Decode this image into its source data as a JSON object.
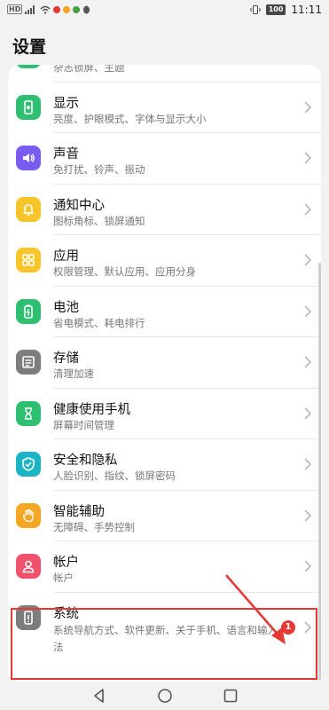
{
  "status_bar": {
    "left_chip": "HD",
    "battery_label": "100",
    "time": "11:11",
    "dot_colors": [
      "#e53935",
      "#f5a623",
      "#43a047"
    ]
  },
  "page_title": "设置",
  "items": [
    {
      "id": "theme",
      "title": "",
      "sub": "杂志锁屏、主题",
      "color": "#2fbf71",
      "icon": "theme-icon"
    },
    {
      "id": "display",
      "title": "显示",
      "sub": "亮度、护眼模式、字体与显示大小",
      "color": "#2fbf71",
      "icon": "display-icon"
    },
    {
      "id": "sound",
      "title": "声音",
      "sub": "免打扰、铃声、振动",
      "color": "#7a5cf0",
      "icon": "speaker-icon"
    },
    {
      "id": "notify",
      "title": "通知中心",
      "sub": "图标角标、锁屏通知",
      "color": "#f7c52a",
      "icon": "bell-icon"
    },
    {
      "id": "apps",
      "title": "应用",
      "sub": "权限管理、默认应用、应用分身",
      "color": "#f7c52a",
      "icon": "apps-grid-icon"
    },
    {
      "id": "battery",
      "title": "电池",
      "sub": "省电模式、耗电排行",
      "color": "#2fbf71",
      "icon": "battery-icon"
    },
    {
      "id": "storage",
      "title": "存储",
      "sub": "清理加速",
      "color": "#7d7d7d",
      "icon": "storage-icon"
    },
    {
      "id": "health",
      "title": "健康使用手机",
      "sub": "屏幕时间管理",
      "color": "#2fbf71",
      "icon": "hourglass-icon"
    },
    {
      "id": "security",
      "title": "安全和隐私",
      "sub": "人脸识别、指纹、锁屏密码",
      "color": "#1bb4c4",
      "icon": "shield-icon"
    },
    {
      "id": "accessibility",
      "title": "智能辅助",
      "sub": "无障碍、手势控制",
      "color": "#f5a623",
      "icon": "hand-icon"
    },
    {
      "id": "account",
      "title": "帐户",
      "sub": "帐户",
      "color": "#f0516b",
      "icon": "person-icon"
    },
    {
      "id": "system",
      "title": "系统",
      "sub": "系统导航方式、软件更新、关于手机、语言和输入法",
      "color": "#7d7d7d",
      "icon": "phone-system-icon",
      "badge": "1"
    }
  ],
  "nav": {
    "back": "back-icon",
    "home": "home-icon",
    "recents": "recents-icon"
  }
}
